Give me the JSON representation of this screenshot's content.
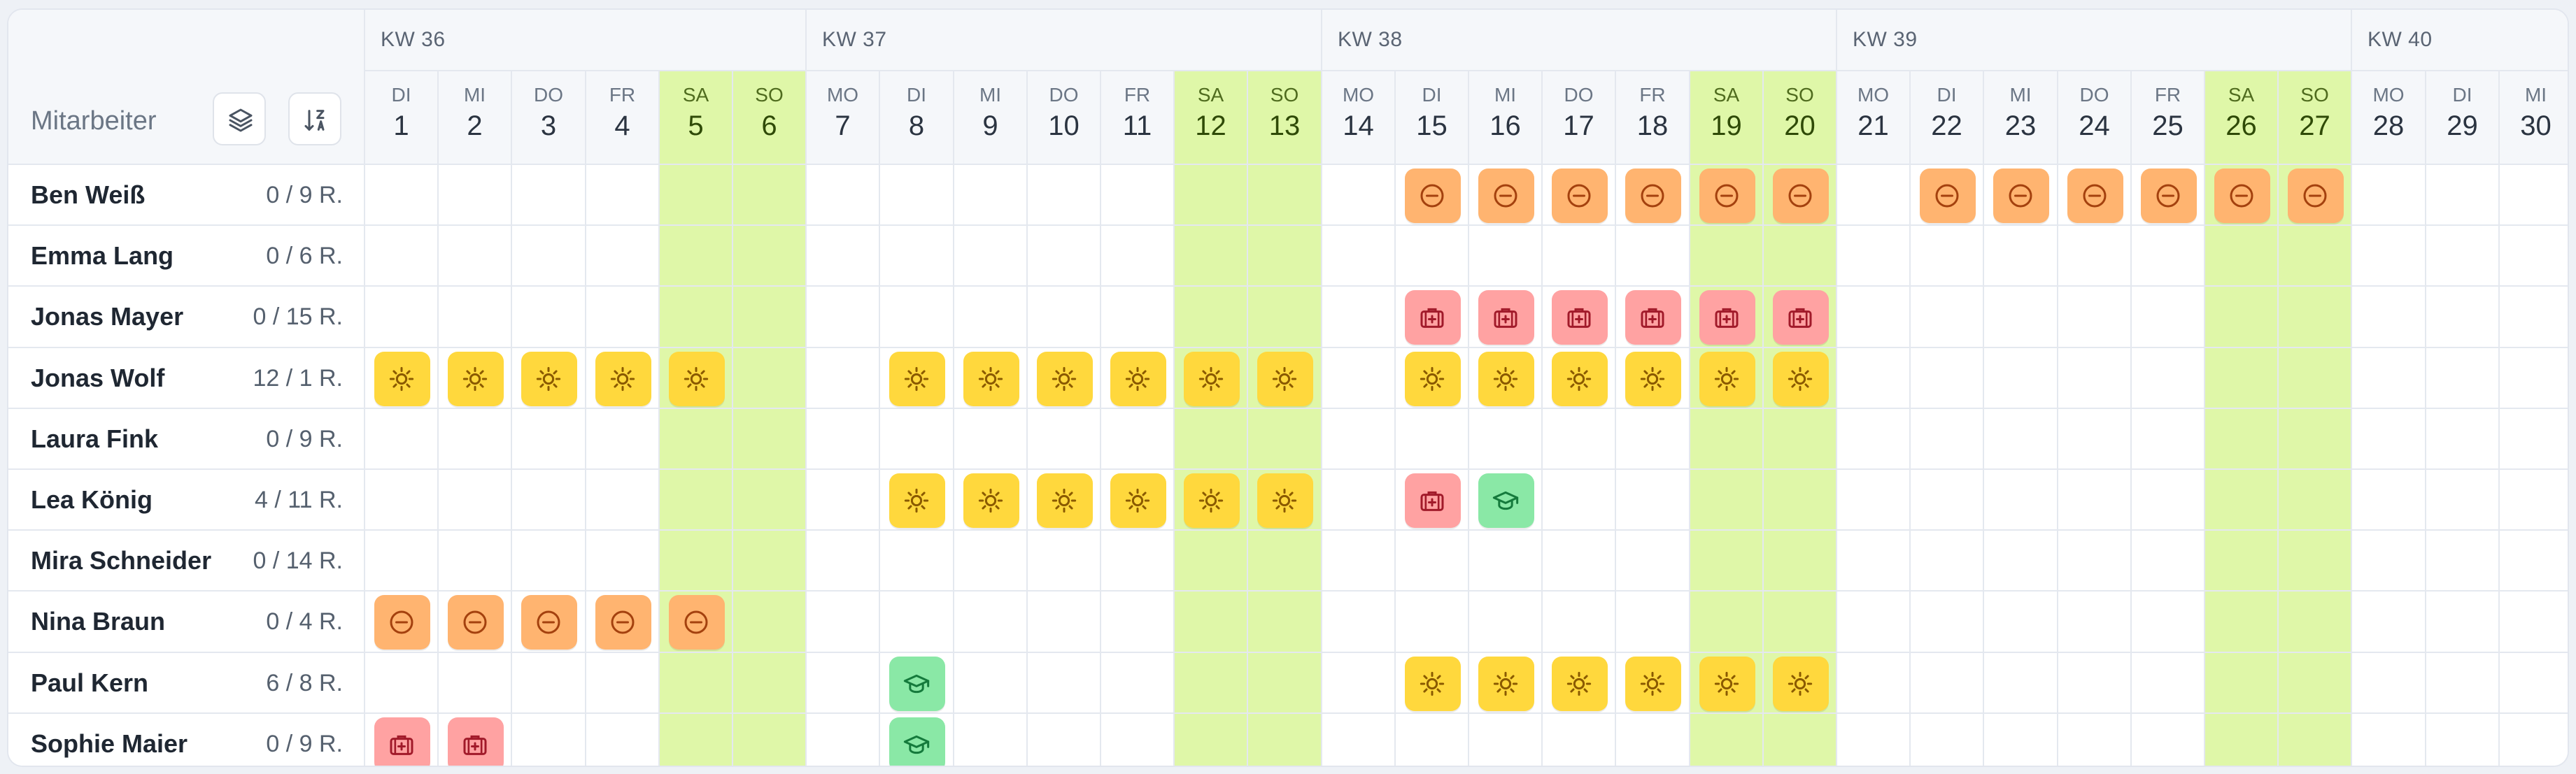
{
  "header": {
    "title": "Mitarbeiter",
    "layers_icon": "layers-icon",
    "sort_icon": "sort-ascending-icon"
  },
  "weeks": [
    {
      "label": "KW 36",
      "span": 6
    },
    {
      "label": "KW 37",
      "span": 7
    },
    {
      "label": "KW 38",
      "span": 7
    },
    {
      "label": "KW 39",
      "span": 7
    },
    {
      "label": "KW 40",
      "span": 3
    }
  ],
  "days": [
    {
      "dow": "DI",
      "num": "1",
      "weekend": false
    },
    {
      "dow": "MI",
      "num": "2",
      "weekend": false
    },
    {
      "dow": "DO",
      "num": "3",
      "weekend": false
    },
    {
      "dow": "FR",
      "num": "4",
      "weekend": false
    },
    {
      "dow": "SA",
      "num": "5",
      "weekend": true
    },
    {
      "dow": "SO",
      "num": "6",
      "weekend": true
    },
    {
      "dow": "MO",
      "num": "7",
      "weekend": false
    },
    {
      "dow": "DI",
      "num": "8",
      "weekend": false
    },
    {
      "dow": "MI",
      "num": "9",
      "weekend": false
    },
    {
      "dow": "DO",
      "num": "10",
      "weekend": false
    },
    {
      "dow": "FR",
      "num": "11",
      "weekend": false
    },
    {
      "dow": "SA",
      "num": "12",
      "weekend": true
    },
    {
      "dow": "SO",
      "num": "13",
      "weekend": true
    },
    {
      "dow": "MO",
      "num": "14",
      "weekend": false
    },
    {
      "dow": "DI",
      "num": "15",
      "weekend": false
    },
    {
      "dow": "MI",
      "num": "16",
      "weekend": false
    },
    {
      "dow": "DO",
      "num": "17",
      "weekend": false
    },
    {
      "dow": "FR",
      "num": "18",
      "weekend": false
    },
    {
      "dow": "SA",
      "num": "19",
      "weekend": true
    },
    {
      "dow": "SO",
      "num": "20",
      "weekend": true
    },
    {
      "dow": "MO",
      "num": "21",
      "weekend": false
    },
    {
      "dow": "DI",
      "num": "22",
      "weekend": false
    },
    {
      "dow": "MI",
      "num": "23",
      "weekend": false
    },
    {
      "dow": "DO",
      "num": "24",
      "weekend": false
    },
    {
      "dow": "FR",
      "num": "25",
      "weekend": false
    },
    {
      "dow": "SA",
      "num": "26",
      "weekend": true
    },
    {
      "dow": "SO",
      "num": "27",
      "weekend": true
    },
    {
      "dow": "MO",
      "num": "28",
      "weekend": false
    },
    {
      "dow": "DI",
      "num": "29",
      "weekend": false
    },
    {
      "dow": "MI",
      "num": "30",
      "weekend": false
    }
  ],
  "employees": [
    {
      "name": "Ben Weiß",
      "quota": "0 / 9 R.",
      "entries": [
        {
          "type": "dayoff",
          "days": [
            15,
            16,
            17,
            18,
            19,
            20,
            22,
            23,
            24,
            25,
            26,
            27
          ]
        }
      ]
    },
    {
      "name": "Emma Lang",
      "quota": "0 / 6 R.",
      "entries": []
    },
    {
      "name": "Jonas Mayer",
      "quota": "0 / 15 R.",
      "entries": [
        {
          "type": "sick",
          "days": [
            15,
            16,
            17,
            18,
            19,
            20
          ]
        }
      ]
    },
    {
      "name": "Jonas Wolf",
      "quota": "12 / 1 R.",
      "entries": [
        {
          "type": "vacation",
          "days": [
            1,
            2,
            3,
            4,
            5,
            8,
            9,
            10,
            11,
            12,
            13,
            15,
            16,
            17,
            18,
            19,
            20
          ]
        }
      ]
    },
    {
      "name": "Laura Fink",
      "quota": "0 / 9 R.",
      "entries": []
    },
    {
      "name": "Lea König",
      "quota": "4 / 11 R.",
      "entries": [
        {
          "type": "vacation",
          "days": [
            8,
            9,
            10,
            11,
            12,
            13
          ]
        },
        {
          "type": "sick",
          "days": [
            15
          ]
        },
        {
          "type": "training",
          "days": [
            16
          ]
        }
      ]
    },
    {
      "name": "Mira Schneider",
      "quota": "0 / 14 R.",
      "entries": []
    },
    {
      "name": "Nina Braun",
      "quota": "0 / 4 R.",
      "entries": [
        {
          "type": "dayoff",
          "days": [
            1,
            2,
            3,
            4,
            5
          ]
        }
      ]
    },
    {
      "name": "Paul Kern",
      "quota": "6 / 8 R.",
      "entries": [
        {
          "type": "training",
          "days": [
            8
          ]
        },
        {
          "type": "vacation",
          "days": [
            15,
            16,
            17,
            18,
            19,
            20
          ]
        }
      ]
    },
    {
      "name": "Sophie Maier",
      "quota": "0 / 9 R.",
      "entries": [
        {
          "type": "sick",
          "days": [
            1,
            2
          ]
        },
        {
          "type": "training",
          "days": [
            8
          ]
        }
      ]
    }
  ],
  "absence_types": {
    "vacation": {
      "icon": "sun-icon",
      "color": "#ffd83d",
      "stroke": "#8a5a00"
    },
    "dayoff": {
      "icon": "minus-circle-icon",
      "color": "#ffb470",
      "stroke": "#a4410e"
    },
    "sick": {
      "icon": "medical-kit-icon",
      "color": "#ffa2a2",
      "stroke": "#a11a2a"
    },
    "training": {
      "icon": "graduation-cap-icon",
      "color": "#8ae8a6",
      "stroke": "#157a3c"
    }
  }
}
